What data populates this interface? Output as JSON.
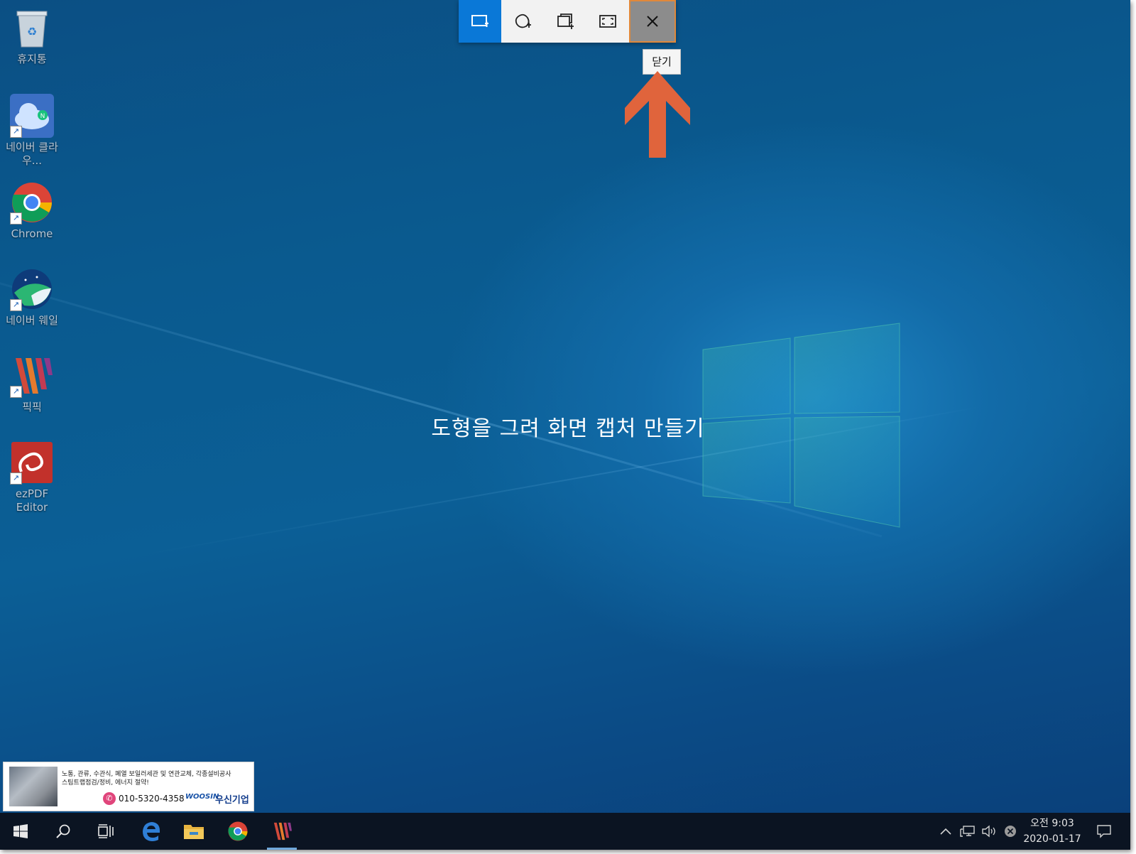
{
  "desktop": {
    "icons": [
      {
        "label": "휴지통",
        "icon": "recycle-bin-icon"
      },
      {
        "label": "네이버 클라우...",
        "icon": "naver-cloud-icon"
      },
      {
        "label": "Chrome",
        "icon": "chrome-icon"
      },
      {
        "label": "네이버 웨일",
        "icon": "naver-whale-icon"
      },
      {
        "label": "픽픽",
        "icon": "picpick-icon"
      },
      {
        "label": "ezPDF Editor",
        "icon": "ezpdf-icon"
      }
    ]
  },
  "snip_toolbar": {
    "buttons": [
      {
        "name": "rectangular-snip",
        "icon": "rectangle-snip-icon",
        "active": true
      },
      {
        "name": "freeform-snip",
        "icon": "freeform-snip-icon",
        "active": false
      },
      {
        "name": "window-snip",
        "icon": "window-snip-icon",
        "active": false
      },
      {
        "name": "fullscreen-snip",
        "icon": "fullscreen-snip-icon",
        "active": false
      },
      {
        "name": "close",
        "icon": "close-icon",
        "active": false
      }
    ],
    "tooltip": "닫기"
  },
  "overlay_text": "도형을 그려 화면 캡처 만들기",
  "ad": {
    "line1": "노통, 관류, 수관식, 폐열 보일러세관 및 연관교체, 각종설비공사",
    "line2": "스팀트랩점검/정비, 에너지 절약!",
    "phone": "010-5320-4358",
    "brand": "WOOSIN",
    "company": "우신기업"
  },
  "taskbar": {
    "apps": [
      "start-icon",
      "search-icon",
      "task-view-icon",
      "edge-icon",
      "file-explorer-icon",
      "chrome-icon",
      "picpick-icon"
    ],
    "clock": {
      "time": "오전 9:03",
      "date": "2020-01-17"
    }
  },
  "colors": {
    "accent": "#0a78d7",
    "arrow": "#e0643c",
    "desktop": "#0b5a8f",
    "taskbar": "#0b1422"
  }
}
